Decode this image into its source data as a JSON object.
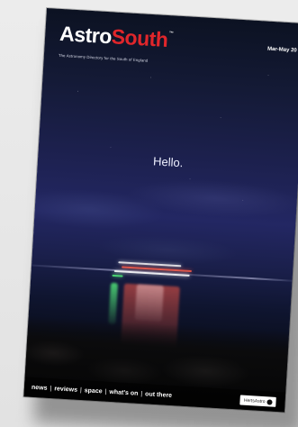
{
  "cover": {
    "masthead": {
      "part1": "Astro",
      "part2": "South",
      "trademark": "™"
    },
    "tagline": "The Astronomy Directory for the South of England",
    "issue": "Mar-May 20",
    "headline": "Hello.",
    "nav": {
      "items": [
        "news",
        "reviews",
        "space",
        "what's on",
        "out there"
      ],
      "separator": "|"
    },
    "sponsor": {
      "label": "HertsAstro"
    },
    "colors": {
      "brand_red": "#e0262b",
      "sky_top": "#0c1222",
      "sky_mid": "#232763",
      "ship_light_white": "#ffffff",
      "ship_light_red": "#ff4a3a",
      "ship_light_green": "#3fe06a"
    }
  }
}
